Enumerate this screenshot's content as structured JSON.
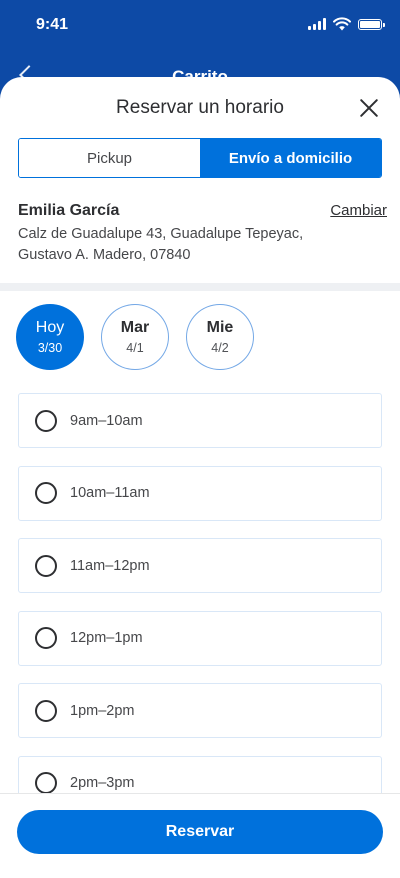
{
  "status_bar": {
    "time": "9:41",
    "icons": [
      "signal-icon",
      "wifi-icon",
      "battery-icon"
    ]
  },
  "app_header": {
    "title": "Carrito",
    "back_icon": "chevron-left-icon"
  },
  "sheet": {
    "title": "Reservar un horario",
    "close_icon": "close-icon",
    "segments": [
      {
        "label": "Pickup",
        "selected": false
      },
      {
        "label": "Envío a domicilio",
        "selected": true
      }
    ],
    "address": {
      "name": "Emilia García",
      "change_label": "Cambiar",
      "line1": "Calz de Guadalupe 43, Guadalupe Tepeyac,",
      "line2": "Gustavo A. Madero, 07840"
    },
    "days": [
      {
        "name": "Hoy",
        "date": "3/30",
        "selected": true
      },
      {
        "name": "Mar",
        "date": "4/1",
        "selected": false
      },
      {
        "name": "Mie",
        "date": "4/2",
        "selected": false
      }
    ],
    "slots": [
      {
        "label": "9am–10am"
      },
      {
        "label": "10am–11am"
      },
      {
        "label": "11am–12pm"
      },
      {
        "label": "12pm–1pm"
      },
      {
        "label": "1pm–2pm"
      },
      {
        "label": "2pm–3pm"
      }
    ],
    "reserve_button": "Reservar"
  },
  "colors": {
    "brand_blue": "#0071dc",
    "header_blue": "#0d4aa6",
    "slot_border": "#d9e7f7"
  }
}
